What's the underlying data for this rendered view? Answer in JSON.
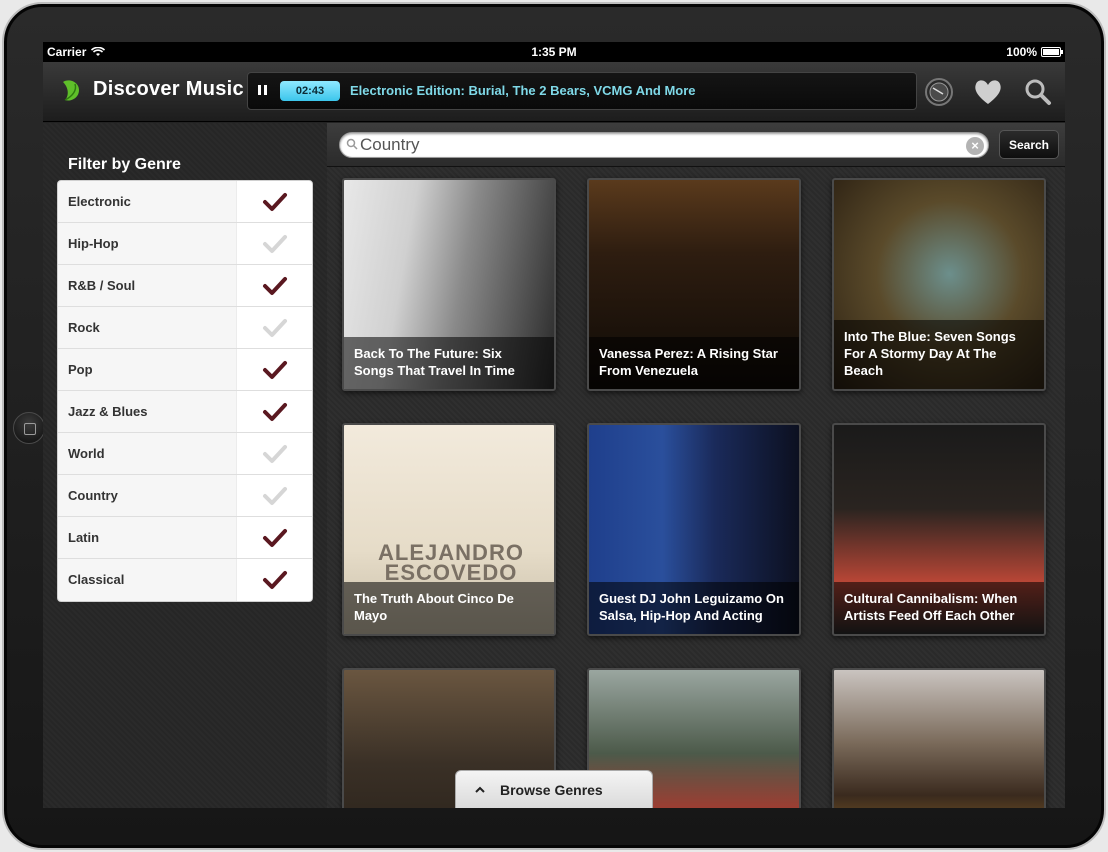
{
  "status_bar": {
    "carrier": "Carrier",
    "time": "1:35 PM",
    "battery": "100%"
  },
  "app": {
    "title": "Discover Music"
  },
  "player": {
    "elapsed": "02:43",
    "track": "Electronic Edition: Burial, The 2 Bears, VCMG And More"
  },
  "header_icons": [
    "radio-dial-icon",
    "heart-icon",
    "search-icon"
  ],
  "sidebar": {
    "title": "Filter by Genre",
    "genres": [
      {
        "name": "Electronic",
        "checked": true
      },
      {
        "name": "Hip-Hop",
        "checked": false
      },
      {
        "name": "R&B / Soul",
        "checked": true
      },
      {
        "name": "Rock",
        "checked": false
      },
      {
        "name": "Pop",
        "checked": true
      },
      {
        "name": "Jazz & Blues",
        "checked": true
      },
      {
        "name": "World",
        "checked": false
      },
      {
        "name": "Country",
        "checked": false
      },
      {
        "name": "Latin",
        "checked": true
      },
      {
        "name": "Classical",
        "checked": true
      }
    ]
  },
  "search": {
    "value": "Country",
    "button": "Search"
  },
  "cards": [
    {
      "caption": "Back To The Future: Six Songs That Travel In Time"
    },
    {
      "caption": "Vanessa Perez: A Rising Star From Venezuela"
    },
    {
      "caption": "Into The Blue: Seven Songs For A Stormy Day At The Beach"
    },
    {
      "caption": "The Truth About Cinco De Mayo",
      "image_text": [
        "ALEJANDRO",
        "ESCOVEDO"
      ]
    },
    {
      "caption": "Guest DJ John Leguizamo On Salsa, Hip-Hop And Acting"
    },
    {
      "caption": "Cultural Cannibalism: When Artists Feed Off Each Other"
    },
    {
      "caption": ""
    },
    {
      "caption": ""
    },
    {
      "caption": ""
    }
  ],
  "browse_tab": {
    "label": "Browse Genres"
  },
  "colors": {
    "accent_cyan": "#3cc6ec",
    "track_text": "#7fd9e8",
    "check_on": "#5a1820",
    "check_off": "#d6d6d6",
    "logo_green": "#5fbf2a"
  }
}
